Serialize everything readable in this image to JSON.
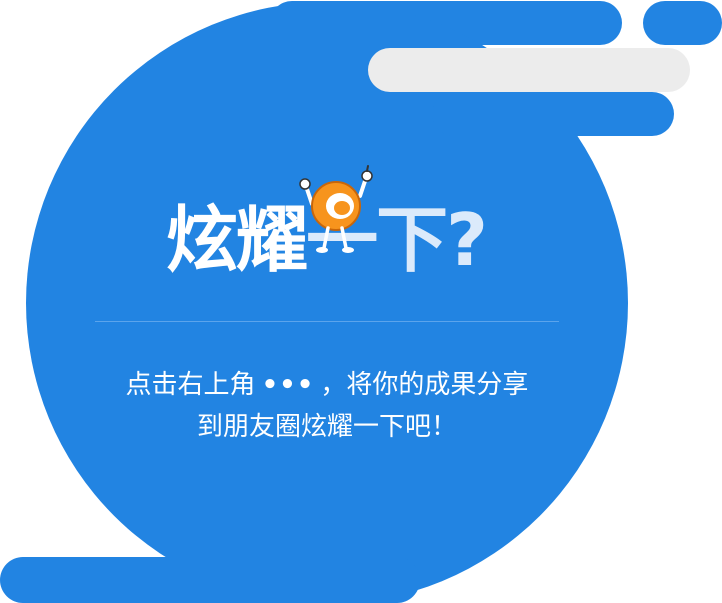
{
  "colors": {
    "primary_blue": "#2284e2",
    "gray_bar": "#ececec",
    "text": "#ffffff",
    "mascot_orange": "#f7941d"
  },
  "title": {
    "part1": "炫耀",
    "part2": "一下?"
  },
  "mascot": {
    "icon": "mascot-icon"
  },
  "instruction": {
    "line1_before": "点击右上角",
    "dots": "•••",
    "line1_after": "，将你的成果分享",
    "line2": "到朋友圈炫耀一下吧！"
  }
}
